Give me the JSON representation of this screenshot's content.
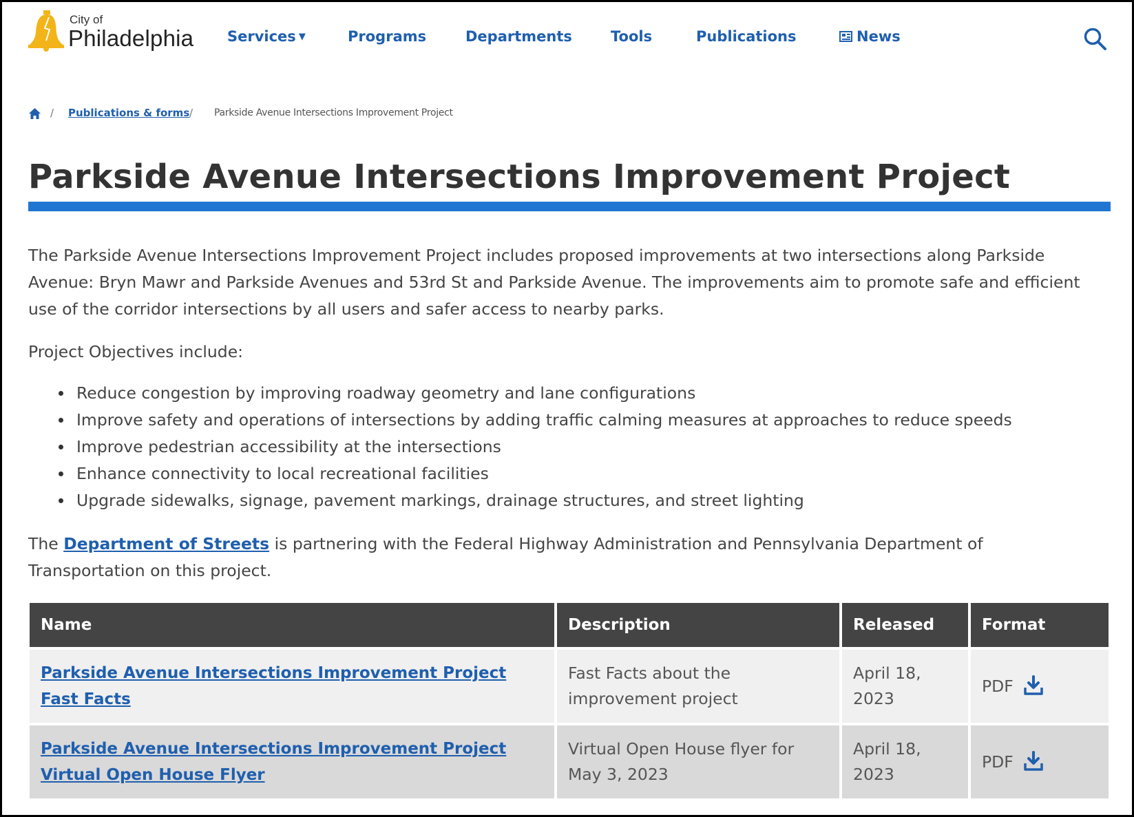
{
  "header": {
    "logo_top": "City of",
    "logo_name": "Philadelphia",
    "nav": {
      "services": "Services",
      "programs": "Programs",
      "departments": "Departments",
      "tools": "Tools",
      "publications": "Publications",
      "news": "News"
    }
  },
  "breadcrumb": {
    "separator": "/",
    "link": "Publications & forms",
    "current": "Parkside Avenue Intersections Improvement Project"
  },
  "page": {
    "title": "Parkside Avenue Intersections Improvement Project",
    "intro": "The Parkside Avenue Intersections Improvement Project includes proposed improvements at two intersections along Parkside Avenue: Bryn Mawr and Parkside Avenues and 53rd St and Parkside Avenue. The improvements aim to promote safe and efficient use of the corridor intersections by all users and safer access to nearby parks.",
    "objectives_heading": "Project Objectives include:",
    "objectives": [
      "Reduce congestion by improving roadway geometry and lane configurations",
      "Improve safety and operations of intersections by adding traffic calming measures at approaches to reduce speeds",
      "Improve pedestrian accessibility at the intersections",
      "Enhance connectivity to local recreational facilities",
      "Upgrade sidewalks, signage, pavement markings, drainage structures, and street lighting"
    ],
    "partner_pre": "The ",
    "partner_link": "Department of Streets",
    "partner_post": " is partnering with the Federal Highway Administration and Pennsylvania Department of Transportation on this project."
  },
  "table": {
    "headers": [
      "Name",
      "Description",
      "Released",
      "Format"
    ],
    "rows": [
      {
        "name": "Parkside Avenue Intersections Improvement Project Fast Facts",
        "description": "Fast Facts about the improvement project",
        "released": "April 18, 2023",
        "format": "PDF"
      },
      {
        "name": "Parkside Avenue Intersections Improvement Project Virtual Open House Flyer",
        "description": "Virtual Open House flyer for May 3, 2023",
        "released": "April 18, 2023",
        "format": "PDF"
      }
    ]
  },
  "colors": {
    "link": "#1f5fae",
    "accent_bar": "#2176d2",
    "table_header": "#444444",
    "logo_bell": "#f2b418"
  },
  "icons": [
    "liberty-bell-logo-icon",
    "caret-down-icon",
    "newspaper-icon",
    "search-icon",
    "home-icon",
    "download-icon"
  ]
}
